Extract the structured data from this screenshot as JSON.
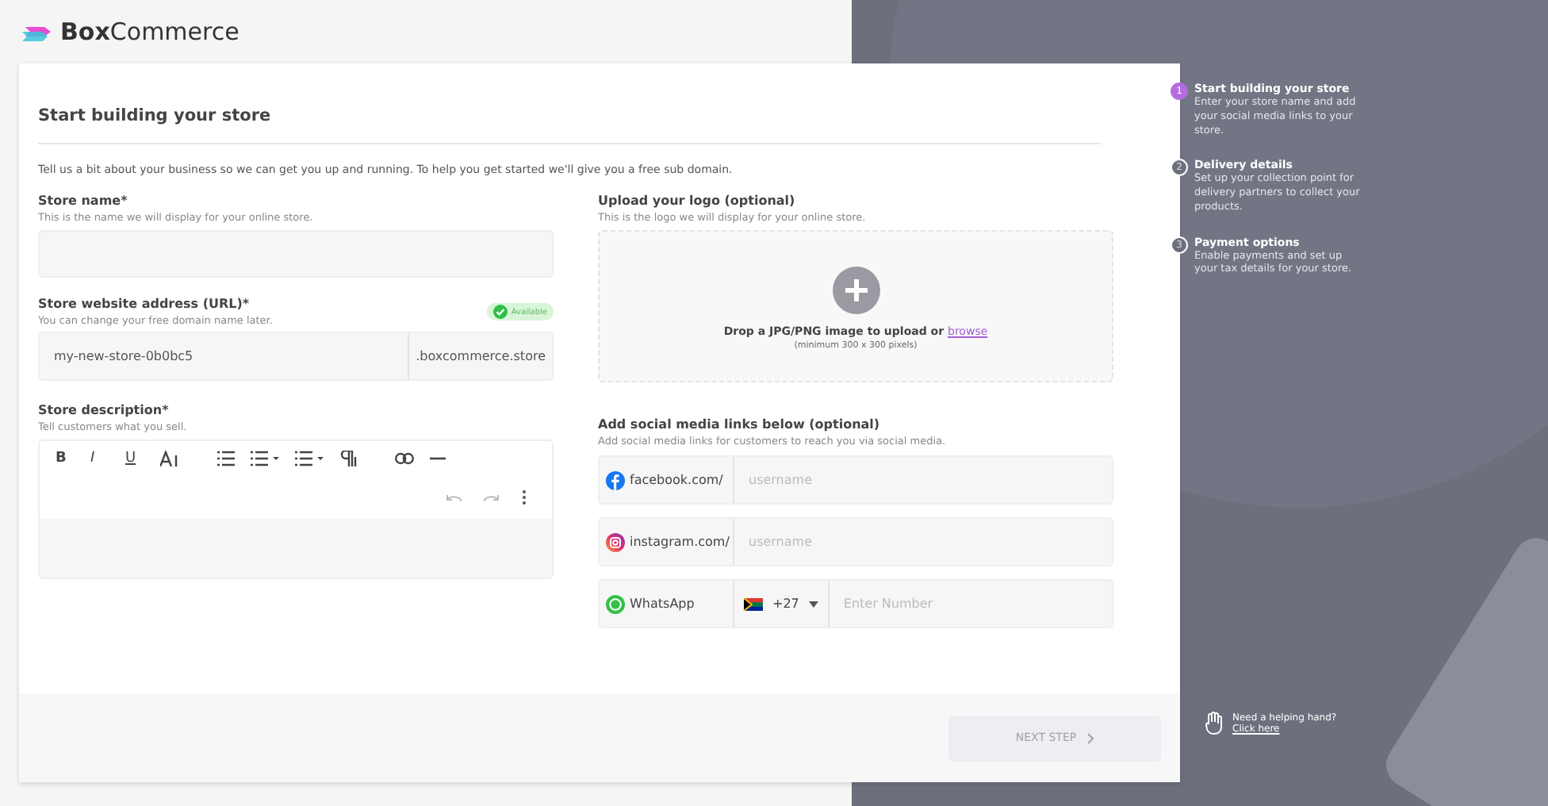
{
  "brand": {
    "name_bold": "Box",
    "name_light": "Commerce"
  },
  "form": {
    "title": "Start building your store",
    "intro": "Tell us a bit about your business so we can get you up and running. To help you get started we'll give you a free sub domain.",
    "store_name": {
      "label": "Store name*",
      "hint": "This is the name we will display for your online store."
    },
    "store_url": {
      "label": "Store website address (URL)*",
      "hint": "You can change your free domain name later.",
      "badge": "Available",
      "value": "my-new-store-0b0bc5",
      "suffix": ".boxcommerce.store"
    },
    "description": {
      "label": "Store description*",
      "hint": "Tell customers what you sell.",
      "text_buttons": [
        "B",
        "I",
        "U"
      ]
    },
    "logo": {
      "label": "Upload your logo (optional)",
      "hint": "This is the logo we will display for your online store.",
      "drop_text": "Drop a JPG/PNG image to upload or",
      "link": "browse",
      "note": "(minimum 300 x 300 pixels)"
    },
    "social": {
      "label": "Add social media links below (optional)",
      "hint": "Add social media links for customers to reach you via social media.",
      "links": [
        {
          "kind": "facebook",
          "prefix": "facebook.com/",
          "placeholder": "username"
        },
        {
          "kind": "instagram",
          "prefix": "instagram.com/",
          "placeholder": "username"
        },
        {
          "kind": "whatsapp",
          "prefix": "WhatsApp",
          "code": "+27",
          "placeholder": "Enter Number"
        }
      ]
    },
    "next_button": {
      "label": "NEXT STEP",
      "disabled": true
    }
  },
  "steps": [
    {
      "number": "1",
      "title": "Start building your store",
      "text": "Enter your store name and add your social media links to your store.",
      "selected": true
    },
    {
      "number": "2",
      "title": "Delivery details",
      "text": "Set up your collection point for delivery partners to collect your products.",
      "selected": false
    },
    {
      "number": "3",
      "title": "Payment options",
      "text": "Enable payments and set up your tax details for your store.",
      "selected": false
    }
  ],
  "help": {
    "text": "Need a helping hand?",
    "link": "Click here"
  }
}
